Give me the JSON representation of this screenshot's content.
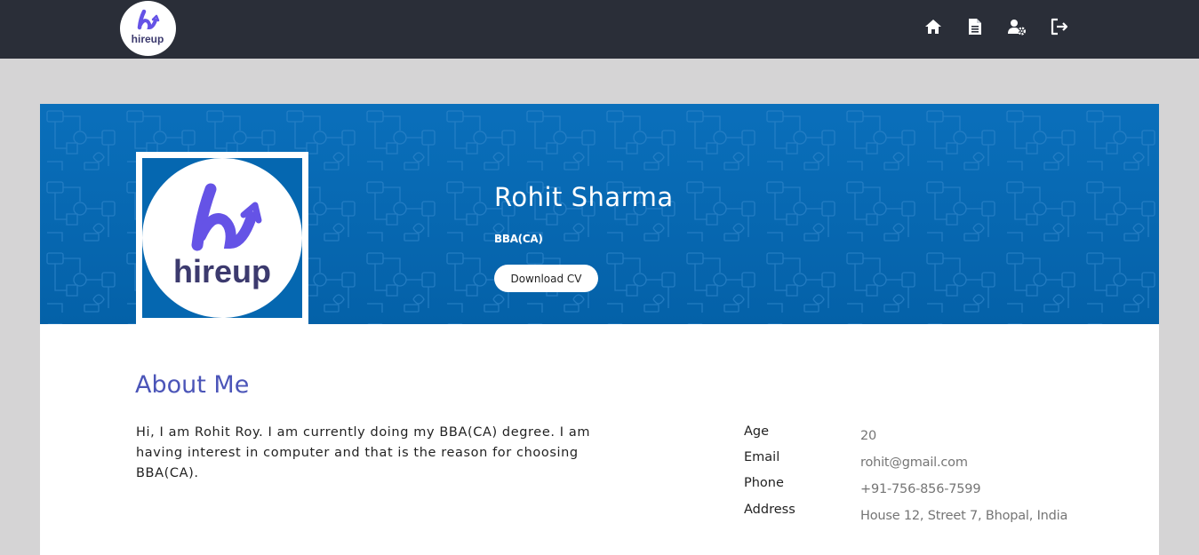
{
  "header": {
    "logo_text": "hireup",
    "icons": [
      "home-icon",
      "document-icon",
      "user-settings-icon",
      "logout-icon"
    ]
  },
  "profile": {
    "name": "Rohit Sharma",
    "degree": "BBA(CA)",
    "download_label": "Download CV",
    "avatar_logo_text": "hireup"
  },
  "about": {
    "title": "About Me",
    "text": "Hi, I am Rohit Roy. I am currently doing my BBA(CA) degree. I am having interest in computer and that is the reason for choosing BBA(CA).",
    "fields": [
      {
        "label": "Age",
        "value": "20"
      },
      {
        "label": "Email",
        "value": "rohit@gmail.com"
      },
      {
        "label": "Phone",
        "value": "+91-756-856-7599"
      },
      {
        "label": "Address",
        "value": "House 12, Street 7, Bhopal, India"
      }
    ]
  },
  "colors": {
    "topbar": "#2a2e38",
    "banner": "#0567b0",
    "brand_purple": "#6553e6",
    "accent_title": "#4b55b8",
    "page_bg": "#d5d4d5"
  }
}
